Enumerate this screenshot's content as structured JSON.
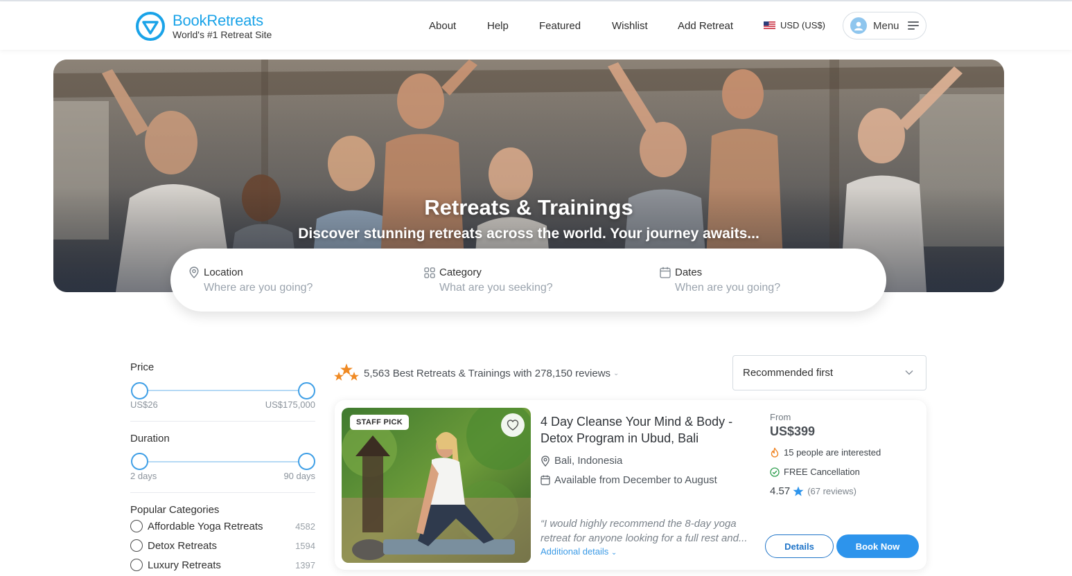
{
  "brand": {
    "name": "BookRetreats",
    "tagline": "World's #1 Retreat Site",
    "color": "#1aa3e8"
  },
  "nav": {
    "links": [
      "About",
      "Help",
      "Featured",
      "Wishlist",
      "Add Retreat"
    ],
    "currency": "USD (US$)",
    "menu_label": "Menu"
  },
  "hero": {
    "title": "Retreats & Trainings",
    "subtitle": "Discover stunning retreats across the world. Your journey awaits..."
  },
  "search": {
    "location": {
      "label": "Location",
      "placeholder": "Where are you going?",
      "icon": "map-pin-icon"
    },
    "category": {
      "label": "Category",
      "placeholder": "What are you seeking?",
      "icon": "grid-icon"
    },
    "dates": {
      "label": "Dates",
      "placeholder": "When are you going?",
      "icon": "calendar-icon"
    }
  },
  "filters": {
    "price": {
      "title": "Price",
      "min": "US$26",
      "max": "US$175,000"
    },
    "duration": {
      "title": "Duration",
      "min": "2 days",
      "max": "90 days"
    },
    "categories_title": "Popular Categories",
    "categories": [
      {
        "label": "Affordable Yoga Retreats",
        "count": "4582"
      },
      {
        "label": "Detox Retreats",
        "count": "1594"
      },
      {
        "label": "Luxury Retreats",
        "count": "1397"
      }
    ]
  },
  "results": {
    "summary": "5,563 Best Retreats & Trainings with 278,150 reviews",
    "sort": "Recommended first"
  },
  "listing": {
    "badge": "STAFF PICK",
    "title": "4 Day Cleanse Your Mind & Body - Detox Program in Ubud, Bali",
    "location": "Bali, Indonesia",
    "availability": "Available from December to August",
    "quote_line1": "“I would highly recommend the 8-day yoga",
    "quote_line2": "retreat for anyone looking for a full rest and...",
    "more_link": "Additional details",
    "price_prefix": "From",
    "price": "US$399",
    "interest": "15 people are interested",
    "cancellation": "FREE Cancellation",
    "rating": "4.57",
    "reviews": "(67 reviews)",
    "details_label": "Details",
    "book_label": "Book Now",
    "accent": "#2d94ec"
  }
}
